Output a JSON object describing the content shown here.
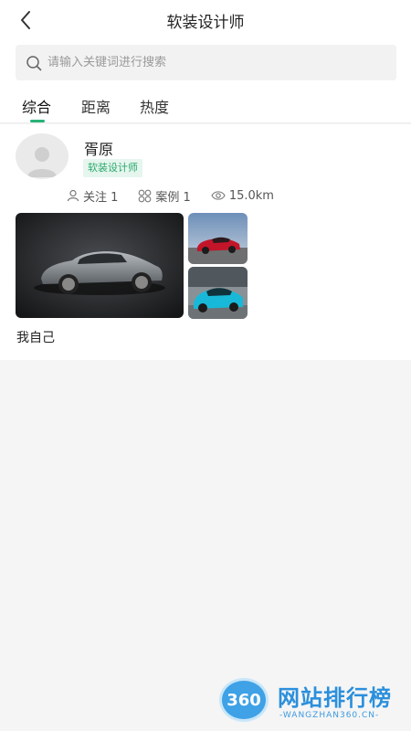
{
  "header": {
    "title": "软装设计师",
    "back_icon": "chevron-left-icon"
  },
  "search": {
    "placeholder": "请输入关键词进行搜索",
    "icon": "search-icon"
  },
  "tabs": [
    {
      "label": "综合",
      "active": true
    },
    {
      "label": "距离",
      "active": false
    },
    {
      "label": "热度",
      "active": false
    }
  ],
  "accent_color": "#27b277",
  "designer": {
    "name": "胥原",
    "role": "软装设计师",
    "stats": {
      "follow": "关注 1",
      "cases": "案例 1",
      "distance": "15.0km"
    },
    "photos": [
      {
        "desc": "grey SUV on dark background"
      },
      {
        "desc": "red sports car"
      },
      {
        "desc": "blue sports car"
      }
    ],
    "caption": "我自己"
  },
  "watermark": {
    "logo": "360",
    "title": "网站排行榜",
    "subtitle": "-WANGZHAN360.CN-"
  }
}
